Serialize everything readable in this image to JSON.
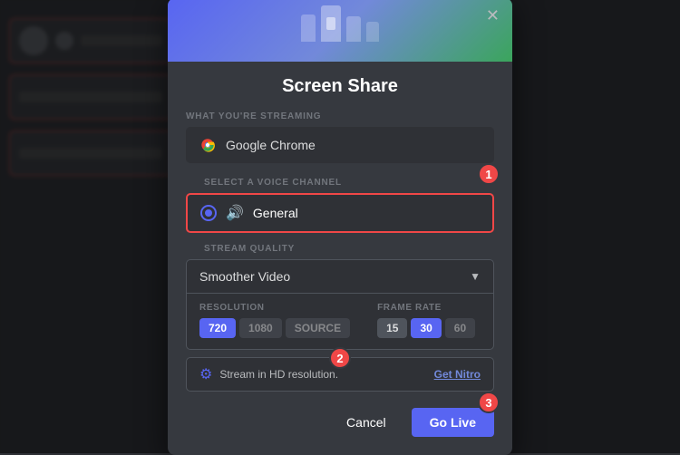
{
  "background": {
    "color": "#2f3136"
  },
  "modal": {
    "title": "Screen Share",
    "close_label": "✕",
    "sections": {
      "streaming": {
        "label": "WHAT YOU'RE STREAMING",
        "value": "Google Chrome"
      },
      "voice": {
        "label": "SELECT A VOICE CHANNEL",
        "channel": "General"
      },
      "quality": {
        "label": "STREAM QUALITY",
        "dropdown_value": "Smoother Video",
        "resolution": {
          "label": "RESOLUTION",
          "options": [
            "720",
            "1080",
            "SOURCE"
          ],
          "active": "720"
        },
        "framerate": {
          "label": "FRAME RATE",
          "options": [
            "15",
            "30",
            "60"
          ],
          "active": "30"
        }
      }
    },
    "hd_banner": {
      "text": "Stream in HD resolution.",
      "cta": "Get Nitro"
    },
    "footer": {
      "cancel": "Cancel",
      "go_live": "Go Live"
    },
    "badges": [
      "1",
      "2",
      "3"
    ]
  }
}
